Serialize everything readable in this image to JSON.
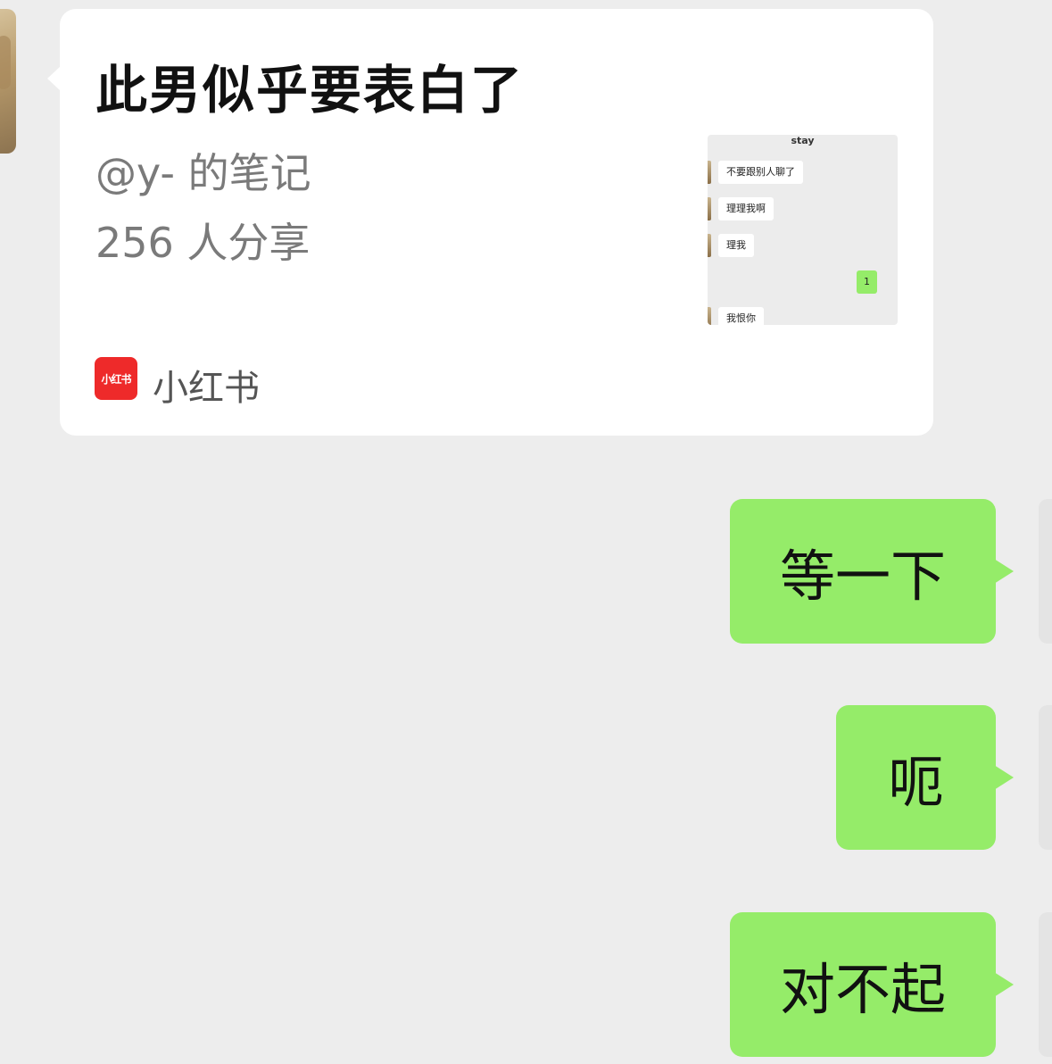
{
  "shared_card": {
    "title": "此男似乎要表白了",
    "author": "@y- 的笔记",
    "shares": "256 人分享",
    "source_logo_text": "小红书",
    "source_name": "小红书",
    "thumbnail": {
      "header": "stay",
      "messages": [
        {
          "side": "left",
          "text": "不要跟别人聊了"
        },
        {
          "side": "left",
          "text": "理理我啊"
        },
        {
          "side": "left",
          "text": "理我"
        },
        {
          "side": "right",
          "text": "1"
        },
        {
          "side": "left",
          "text": "我恨你"
        }
      ]
    }
  },
  "messages": [
    {
      "side": "right",
      "text": "等一下"
    },
    {
      "side": "right",
      "text": "呃"
    },
    {
      "side": "right",
      "text": "对不起"
    }
  ],
  "colors": {
    "background": "#ededed",
    "bubble_outgoing": "#95ec69",
    "card": "#ffffff",
    "brand_red": "#ee2a2a"
  }
}
